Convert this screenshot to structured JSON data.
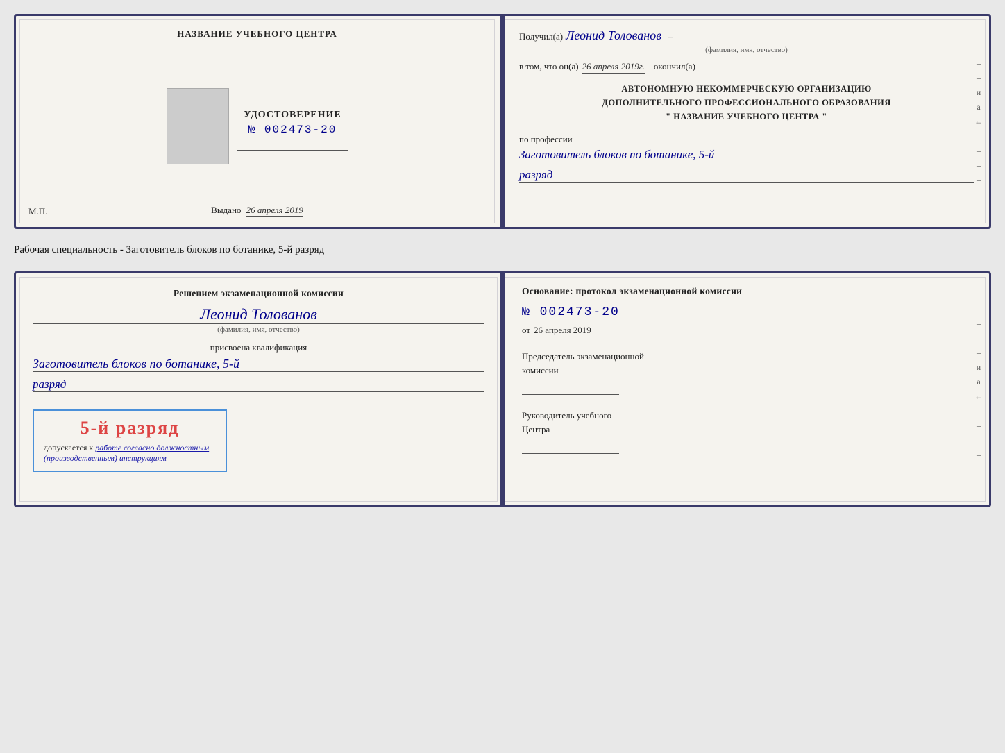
{
  "top_card": {
    "left": {
      "center_title": "НАЗВАНИЕ УЧЕБНОГО ЦЕНТРА",
      "udostoverenie_label": "УДОСТОВЕРЕНИЕ",
      "number": "№ 002473-20",
      "vydano_label": "Выдано",
      "vydano_date": "26 апреля 2019",
      "mp_label": "М.П."
    },
    "right": {
      "poluchil_prefix": "Получил(а)",
      "person_name": "Леонид Толованов",
      "fio_subtitle": "(фамилия, имя, отчество)",
      "vtom_prefix": "в том, что он(а)",
      "vtom_date": "26 апреля 2019г.",
      "okончил": "окончил(а)",
      "org_line1": "АВТОНОМНУЮ НЕКОММЕРЧЕСКУЮ ОРГАНИЗАЦИЮ",
      "org_line2": "ДОПОЛНИТЕЛЬНОГО ПРОФЕССИОНАЛЬНОГО ОБРАЗОВАНИЯ",
      "org_line3": "\"  НАЗВАНИЕ УЧЕБНОГО ЦЕНТРА  \"",
      "po_professii_label": "по профессии",
      "profession_name": "Заготовитель блоков по ботанике, 5-й",
      "razryad": "разряд"
    }
  },
  "specialty_label": "Рабочая специальность - Заготовитель блоков по ботанике, 5-й разряд",
  "bottom_card": {
    "left": {
      "resheniem_line1": "Решением экзаменационной комиссии",
      "person_name": "Леонид Толованов",
      "fio_subtitle": "(фамилия, имя, отчество)",
      "prisvoena_label": "присвоена квалификация",
      "qualification_name": "Заготовитель блоков по ботанике, 5-й",
      "razryad": "разряд",
      "stamp_razryad": "5-й разряд",
      "dopuskaetsya_prefix": "допускается к",
      "dopuskaetsya_italic": "работе согласно должностным",
      "dopuskaetsya_italic2": "(производственным) инструкциям"
    },
    "right": {
      "osnovanie_label": "Основание: протокол экзаменационной комиссии",
      "protocol_number": "№  002473-20",
      "ot_prefix": "от",
      "ot_date": "26 апреля 2019",
      "predsedatel_line1": "Председатель экзаменационной",
      "predsedatel_line2": "комиссии",
      "rukovoditel_line1": "Руководитель учебного",
      "rukovoditel_line2": "Центра"
    }
  },
  "side_chars": {
    "и": "и",
    "а": "а",
    "arrow": "←"
  }
}
